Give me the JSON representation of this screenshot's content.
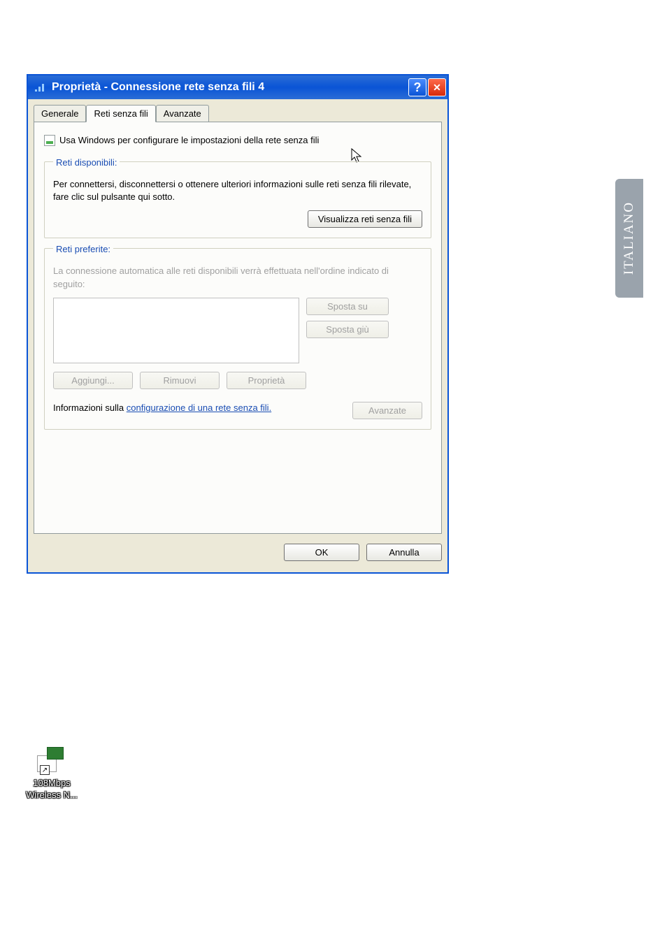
{
  "window": {
    "title": "Proprietà - Connessione rete senza fili 4",
    "help_symbol": "?",
    "close_symbol": "✕"
  },
  "tabs": {
    "general": "Generale",
    "wireless": "Reti senza fili",
    "advanced": "Avanzate"
  },
  "checkbox": {
    "label": "Usa Windows per configurare le impostazioni della rete senza fili"
  },
  "available": {
    "legend": "Reti disponibili:",
    "help": "Per connettersi, disconnettersi o ottenere ulteriori informazioni sulle reti senza fili rilevate, fare clic sul pulsante qui sotto.",
    "view_button": "Visualizza reti senza fili"
  },
  "preferred": {
    "legend": "Reti preferite:",
    "help": "La connessione automatica alle reti disponibili verrà effettuata nell'ordine indicato di seguito:",
    "move_up": "Sposta su",
    "move_down": "Sposta giù",
    "add": "Aggiungi...",
    "remove": "Rimuovi",
    "properties": "Proprietà"
  },
  "info": {
    "prefix": "Informazioni sulla ",
    "link": "configurazione di una rete senza fili.",
    "advanced_button": "Avanzate"
  },
  "buttons": {
    "ok": "OK",
    "cancel": "Annulla"
  },
  "side_tab": "ITALIANO",
  "desktop": {
    "line1": "108Mbps",
    "line2": "Wireless N...",
    "shortcut": "↗"
  },
  "cursor_glyph": "↖"
}
